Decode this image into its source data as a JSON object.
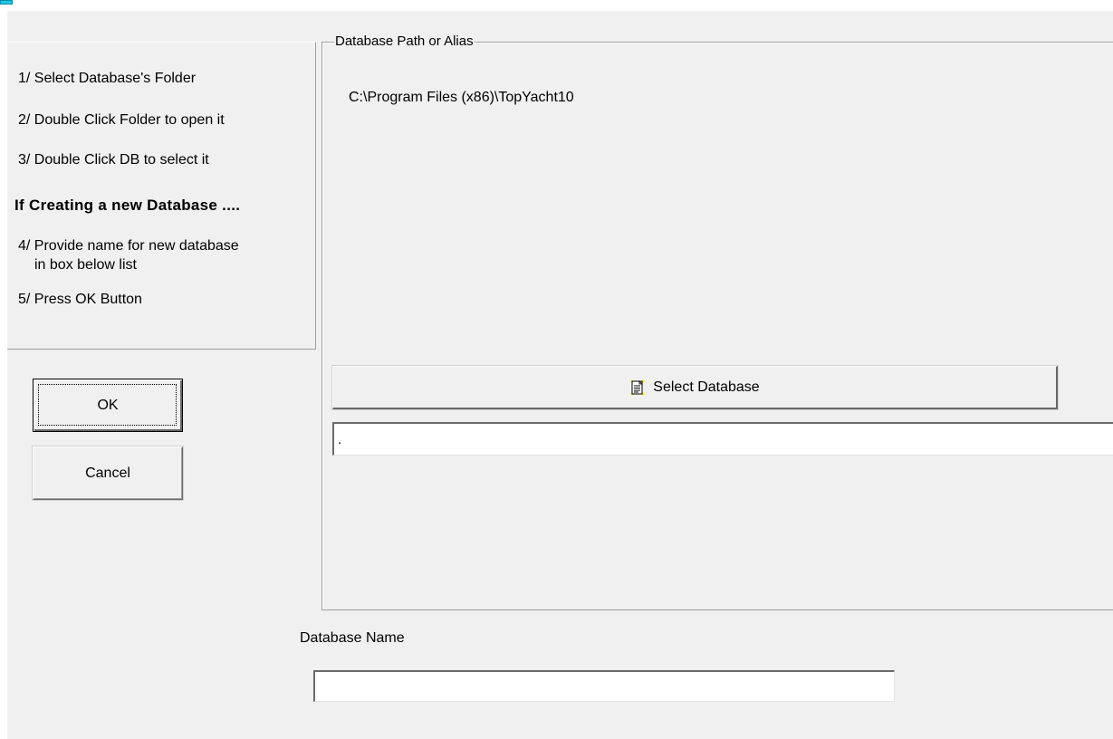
{
  "window": {
    "app_icon": "app-icon"
  },
  "instructions": {
    "steps": [
      "1/ Select Database's Folder",
      "2/ Double Click Folder to open it",
      "3/ Double Click DB to select it"
    ],
    "heading": "If Creating a new Database ....",
    "step4_line1": "4/ Provide name for new database",
    "step4_line2": "in box below list",
    "step5": "5/ Press OK  Button"
  },
  "buttons": {
    "ok_label": "OK",
    "cancel_label": "Cancel",
    "select_database_label": "Select Database",
    "select_database_icon": "document-list-icon"
  },
  "path_group": {
    "legend": "Database Path or Alias",
    "current_path": "C:\\Program Files (x86)\\TopYacht10",
    "folder_field_value": "."
  },
  "db_name": {
    "label": "Database Name",
    "value": ""
  },
  "colors": {
    "dialog_background": "#f0f0f0",
    "icon_highlight": "#ffe600",
    "app_icon": "#1ec7e8"
  }
}
